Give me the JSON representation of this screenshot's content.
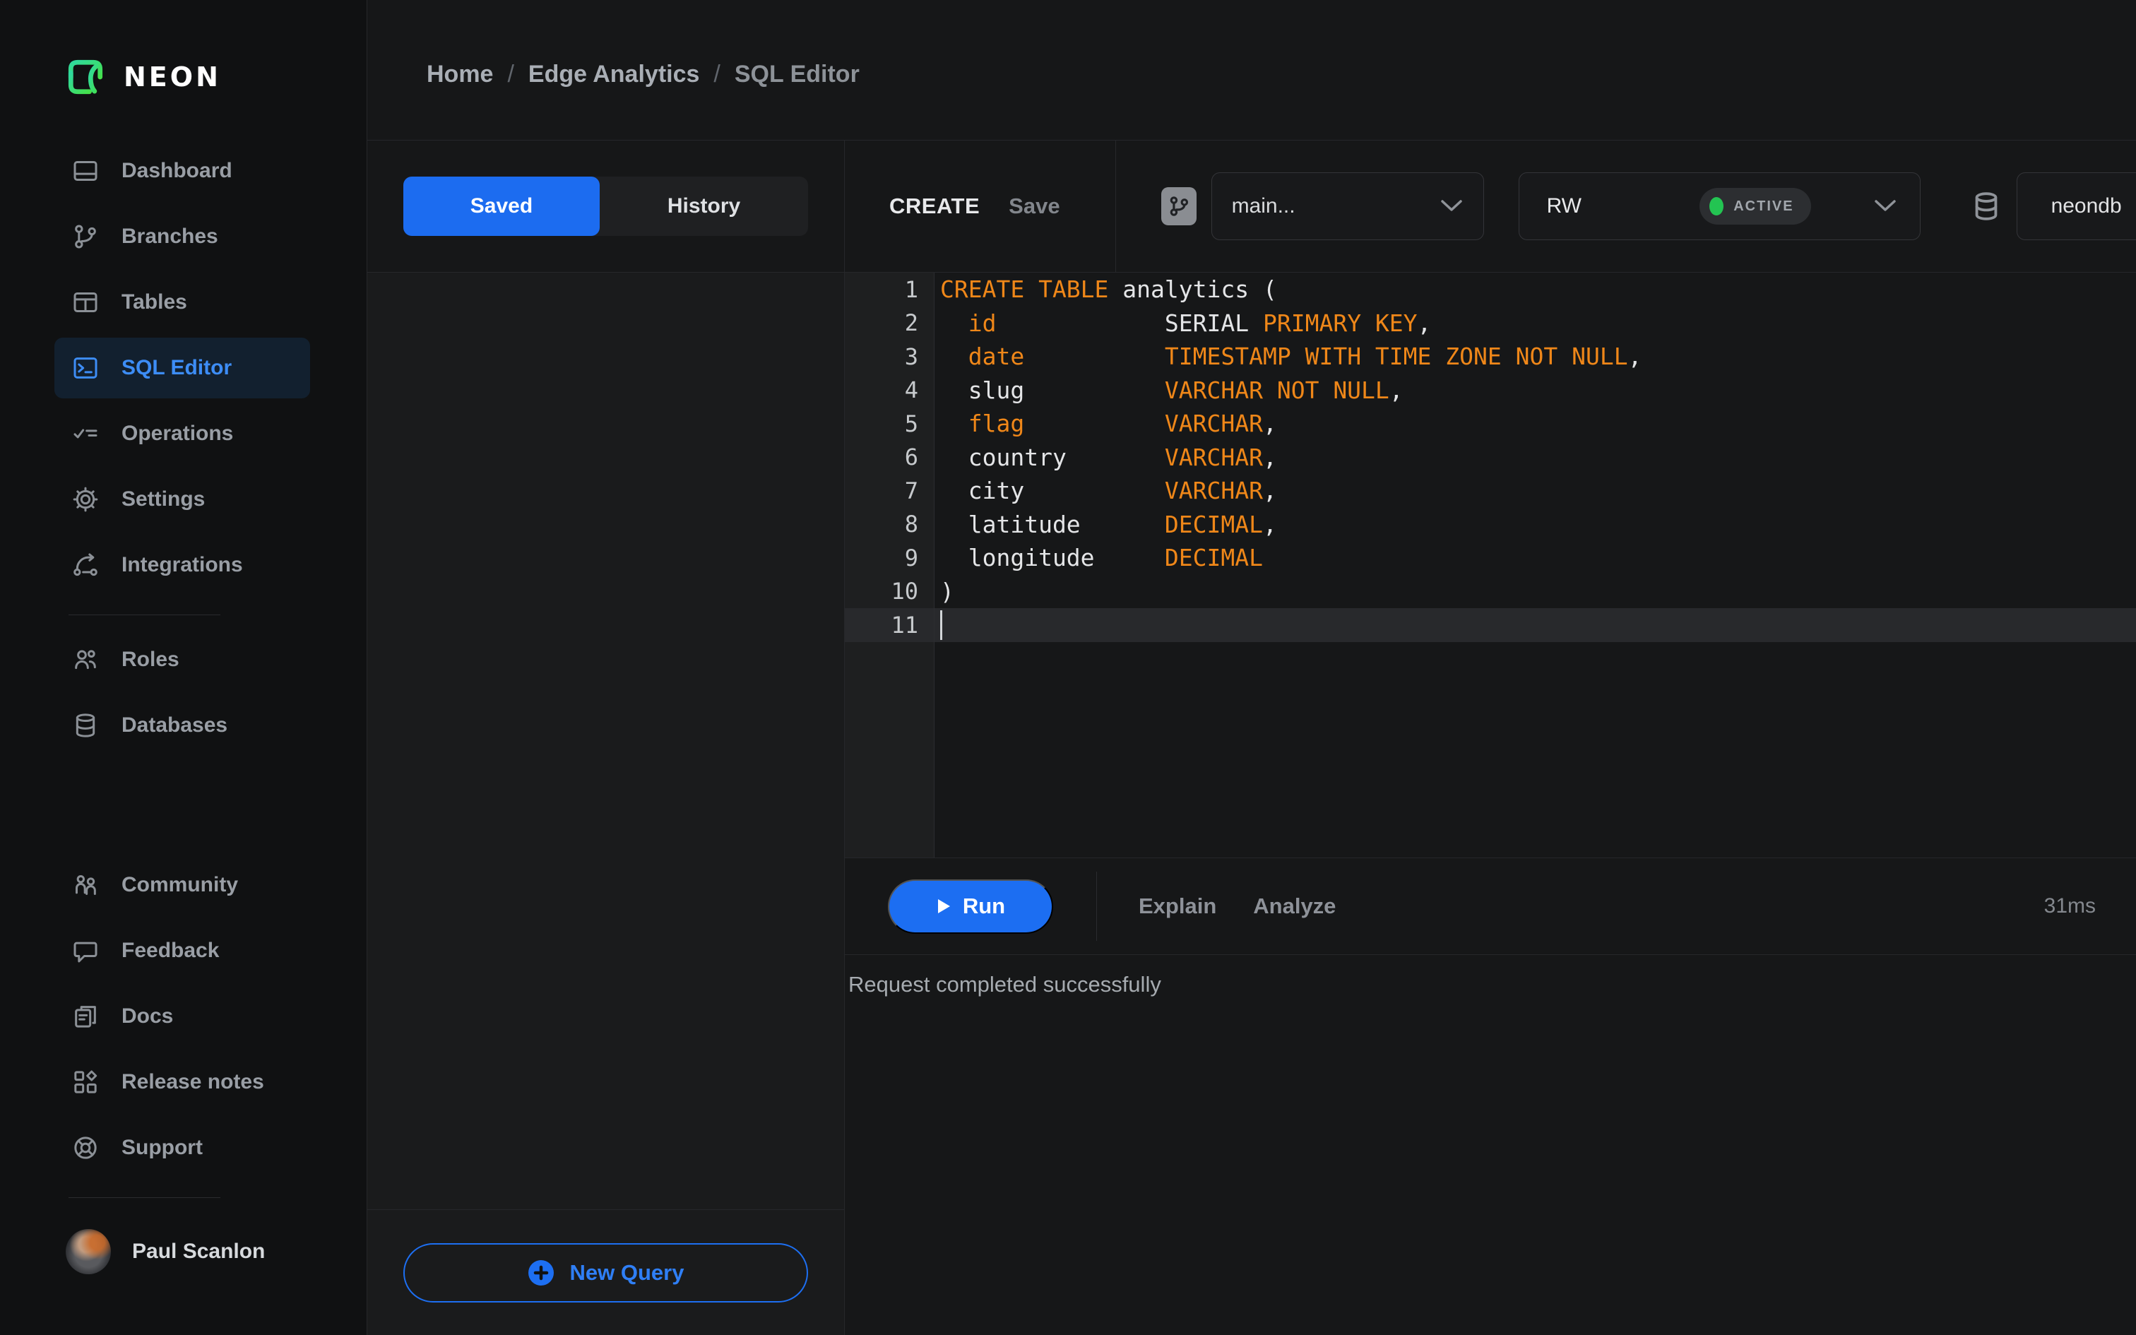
{
  "brand": {
    "name": "NEON"
  },
  "sidebar": {
    "nav_main": [
      {
        "icon": "dashboard",
        "label": "Dashboard",
        "active": false
      },
      {
        "icon": "branches",
        "label": "Branches",
        "active": false
      },
      {
        "icon": "tables",
        "label": "Tables",
        "active": false
      },
      {
        "icon": "sql-editor",
        "label": "SQL Editor",
        "active": true
      },
      {
        "icon": "operations",
        "label": "Operations",
        "active": false
      },
      {
        "icon": "settings",
        "label": "Settings",
        "active": false
      },
      {
        "icon": "integrations",
        "label": "Integrations",
        "active": false
      }
    ],
    "nav_secondary": [
      {
        "icon": "roles",
        "label": "Roles",
        "active": false
      },
      {
        "icon": "databases",
        "label": "Databases",
        "active": false
      }
    ],
    "nav_footer": [
      {
        "icon": "community",
        "label": "Community",
        "active": false
      },
      {
        "icon": "feedback",
        "label": "Feedback",
        "active": false
      },
      {
        "icon": "docs",
        "label": "Docs",
        "active": false
      },
      {
        "icon": "release-notes",
        "label": "Release notes",
        "active": false
      },
      {
        "icon": "support",
        "label": "Support",
        "active": false
      }
    ],
    "user": {
      "name": "Paul Scanlon"
    }
  },
  "breadcrumb": {
    "items": [
      "Home",
      "Edge Analytics",
      "SQL Editor"
    ],
    "separator": "/"
  },
  "left_panel": {
    "tabs": [
      {
        "label": "Saved",
        "active": true
      },
      {
        "label": "History",
        "active": false
      }
    ],
    "new_query_label": "New Query"
  },
  "editor": {
    "tab_title": "CREATE",
    "save_label": "Save",
    "branch_select": {
      "value": "main..."
    },
    "endpoint_select": {
      "value": "RW",
      "status": "ACTIVE"
    },
    "database_select": {
      "value": "neondb"
    },
    "code": {
      "cursor_line": 11,
      "lines": [
        {
          "num": 1,
          "tokens": [
            [
              "CREATE TABLE",
              "k"
            ],
            [
              " analytics (",
              "d"
            ]
          ]
        },
        {
          "num": 2,
          "tokens": [
            [
              "  ",
              "d"
            ],
            [
              "id",
              "k"
            ],
            [
              "            ",
              "d"
            ],
            [
              "SERIAL ",
              "d"
            ],
            [
              "PRIMARY KEY",
              "k"
            ],
            [
              ",",
              "d"
            ]
          ]
        },
        {
          "num": 3,
          "tokens": [
            [
              "  ",
              "d"
            ],
            [
              "date",
              "k"
            ],
            [
              "          ",
              "d"
            ],
            [
              "TIMESTAMP WITH TIME ZONE NOT NULL",
              "k"
            ],
            [
              ",",
              "d"
            ]
          ]
        },
        {
          "num": 4,
          "tokens": [
            [
              "  slug",
              "d"
            ],
            [
              "          ",
              "d"
            ],
            [
              "VARCHAR NOT NULL",
              "k"
            ],
            [
              ",",
              "d"
            ]
          ]
        },
        {
          "num": 5,
          "tokens": [
            [
              "  ",
              "d"
            ],
            [
              "flag",
              "k"
            ],
            [
              "          ",
              "d"
            ],
            [
              "VARCHAR",
              "k"
            ],
            [
              ",",
              "d"
            ]
          ]
        },
        {
          "num": 6,
          "tokens": [
            [
              "  country",
              "d"
            ],
            [
              "       ",
              "d"
            ],
            [
              "VARCHAR",
              "k"
            ],
            [
              ",",
              "d"
            ]
          ]
        },
        {
          "num": 7,
          "tokens": [
            [
              "  city",
              "d"
            ],
            [
              "          ",
              "d"
            ],
            [
              "VARCHAR",
              "k"
            ],
            [
              ",",
              "d"
            ]
          ]
        },
        {
          "num": 8,
          "tokens": [
            [
              "  latitude",
              "d"
            ],
            [
              "      ",
              "d"
            ],
            [
              "DECIMAL",
              "k"
            ],
            [
              ",",
              "d"
            ]
          ]
        },
        {
          "num": 9,
          "tokens": [
            [
              "  longitude",
              "d"
            ],
            [
              "     ",
              "d"
            ],
            [
              "DECIMAL",
              "k"
            ]
          ]
        },
        {
          "num": 10,
          "tokens": [
            [
              ")",
              "d"
            ]
          ]
        },
        {
          "num": 11,
          "tokens": []
        }
      ]
    },
    "actions": {
      "run": "Run",
      "explain": "Explain",
      "analyze": "Analyze",
      "duration": "31ms"
    },
    "status_message": "Request completed successfully"
  },
  "colors": {
    "accent_blue": "#1c6ef2",
    "keyword_orange": "#ef8719",
    "status_green": "#23c452"
  }
}
